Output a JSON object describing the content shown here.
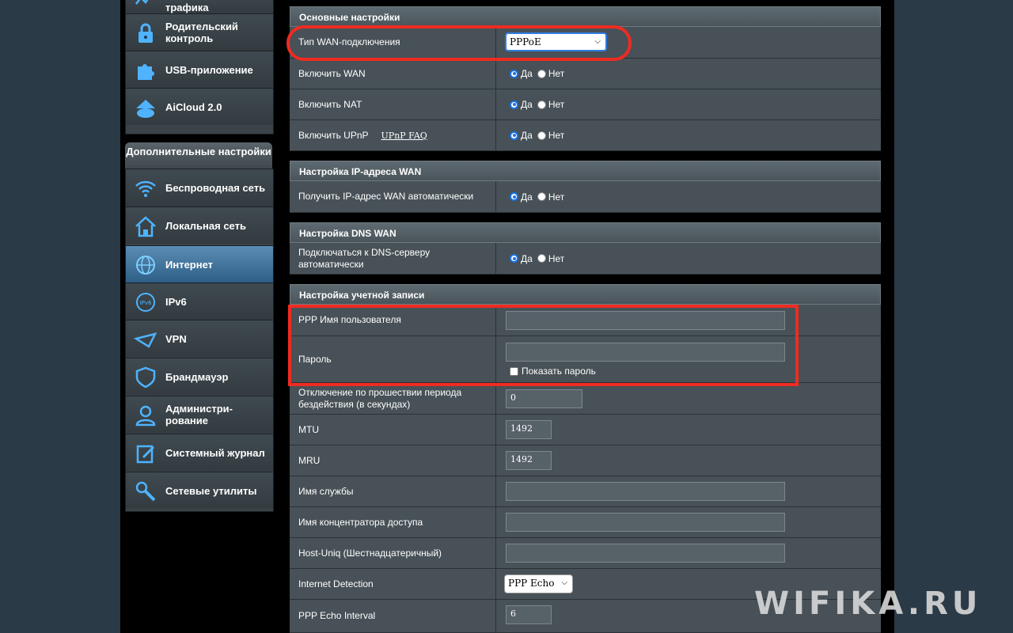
{
  "sidebar": {
    "top_items": [
      {
        "label": "трафика",
        "icon": "traffic-icon"
      },
      {
        "label": "Родительский контроль",
        "icon": "parental-lock-icon"
      },
      {
        "label": "USB-приложение",
        "icon": "puzzle-icon"
      },
      {
        "label": "AiCloud 2.0",
        "icon": "cloud-icon"
      }
    ],
    "group_title": "Дополнительные настройки",
    "items": [
      {
        "label": "Беспроводная сеть",
        "icon": "wifi-icon"
      },
      {
        "label": "Локальная сеть",
        "icon": "home-icon"
      },
      {
        "label": "Интернет",
        "icon": "globe-icon",
        "active": true
      },
      {
        "label": "IPv6",
        "icon": "ipv6-globe-icon"
      },
      {
        "label": "VPN",
        "icon": "vpn-icon"
      },
      {
        "label": "Брандмауэр",
        "icon": "shield-icon"
      },
      {
        "label": "Администри-рование",
        "icon": "admin-user-icon"
      },
      {
        "label": "Системный журнал",
        "icon": "log-edit-icon"
      },
      {
        "label": "Сетевые утилиты",
        "icon": "tools-icon"
      }
    ]
  },
  "sections": {
    "basic": "Основные настройки",
    "ip": "Настройка IP-адреса WAN",
    "dns": "Настройка DNS WAN",
    "account": "Настройка учетной записи"
  },
  "fields": {
    "wan_type_label": "Тип WAN-подключения",
    "wan_type_value": "PPPoE",
    "enable_wan_label": "Включить WAN",
    "enable_nat_label": "Включить NAT",
    "enable_upnp_label": "Включить UPnP",
    "upnp_faq": "UPnP FAQ",
    "auto_ip_label": "Получить IP-адрес WAN автоматически",
    "auto_dns_label": "Подключаться к DNS-серверу автоматически",
    "ppp_user_label": "PPP Имя пользователя",
    "ppp_user_value": "",
    "password_label": "Пароль",
    "password_value": "",
    "show_password": "Показать пароль",
    "idle_label": "Отключение по прошествии периода бездействия (в секундах)",
    "idle_value": "0",
    "mtu_label": "MTU",
    "mtu_value": "1492",
    "mru_label": "MRU",
    "mru_value": "1492",
    "service_label": "Имя службы",
    "service_value": "",
    "ac_label": "Имя концентратора доступа",
    "ac_value": "",
    "hostuniq_label": "Host-Uniq (Шестнадцатеричный)",
    "hostuniq_value": "",
    "detection_label": "Internet Detection",
    "detection_value": "PPP Echo",
    "echo_interval_label": "PPP Echo Interval",
    "echo_interval_value": "6"
  },
  "radio": {
    "yes": "Да",
    "no": "Нет"
  },
  "colors": {
    "annotation": "#ef2b22",
    "active_nav": "#3b6f99"
  },
  "watermark": "WIFIKA.RU"
}
